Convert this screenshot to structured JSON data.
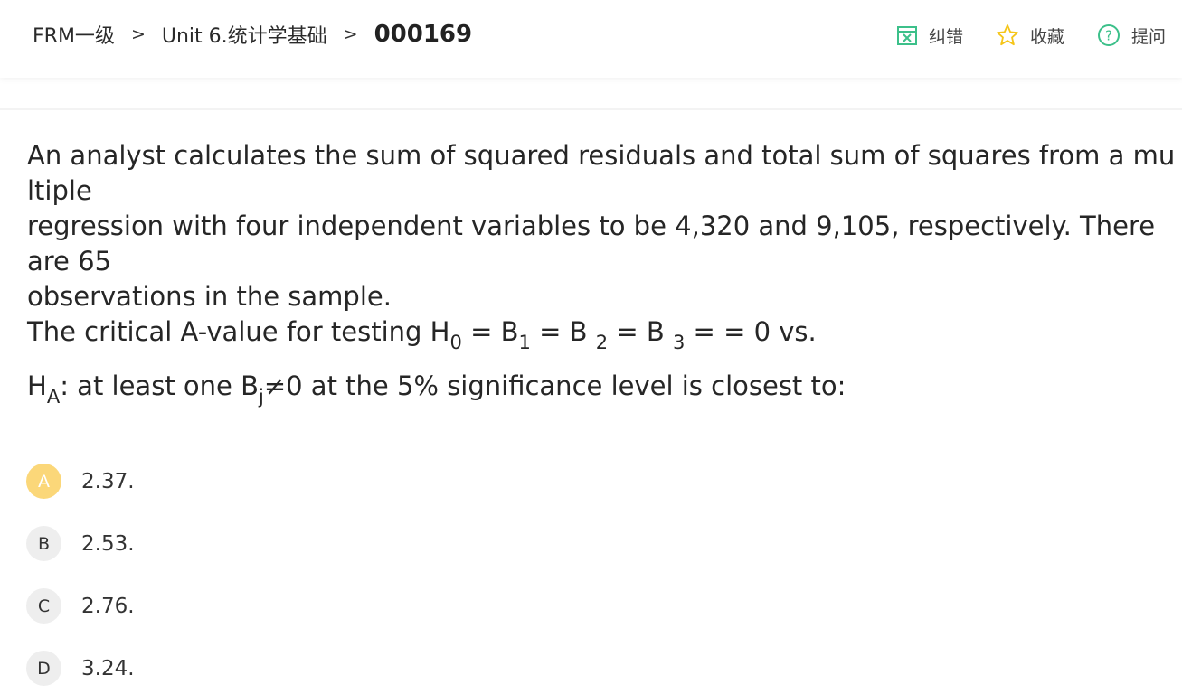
{
  "breadcrumb": {
    "course": "FRM一级",
    "sep1": ">",
    "unit": "Unit 6.统计学基础",
    "sep2": ">",
    "question_id": "000169"
  },
  "actions": {
    "report": {
      "label": "纠错",
      "icon": "report-error-icon",
      "color": "#3cc08a"
    },
    "favorite": {
      "label": "收藏",
      "icon": "star-icon",
      "color": "#f5c518"
    },
    "ask": {
      "label": "提问",
      "icon": "question-circle-icon",
      "color": "#3cc08a"
    }
  },
  "question": {
    "line1": "An analyst calculates the sum of squared residuals and total sum of squares from a multiple",
    "line2": "regression with four independent variables to be 4,320 and 9,105, respectively. There are 65",
    "line3": "observations in the sample.",
    "line4": {
      "t1": "The critical A-value for testing H",
      "s1": "0",
      "t2": " = B",
      "s2": "1",
      "t3": " = B ",
      "s3": "2",
      "t4": " = B ",
      "s4": "3",
      "t5": " =  = 0 vs."
    },
    "line5": {
      "t1": "H",
      "s1": "A",
      "t2": ": at least one B",
      "s2": "j",
      "t3": "≠0 at the 5% significance level is closest to:"
    }
  },
  "options": [
    {
      "letter": "A",
      "text": "2.37.",
      "selected": true
    },
    {
      "letter": "B",
      "text": "2.53.",
      "selected": false
    },
    {
      "letter": "C",
      "text": "2.76.",
      "selected": false
    },
    {
      "letter": "D",
      "text": "3.24.",
      "selected": false
    }
  ],
  "colors": {
    "accent_green": "#3cc08a",
    "selected_badge": "#fbd779",
    "badge_bg": "#eeeeee"
  }
}
